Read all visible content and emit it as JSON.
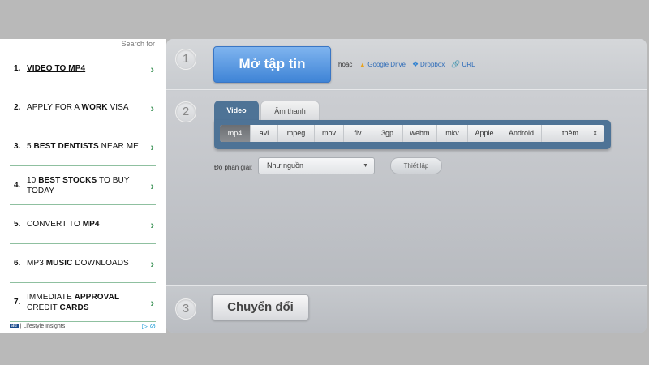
{
  "ad": {
    "search_for": "Search for",
    "items": [
      {
        "num": "1.",
        "parts": [
          {
            "t": "VIDEO TO ",
            "b": false
          },
          {
            "t": "MP4",
            "b": true
          }
        ]
      },
      {
        "num": "2.",
        "parts": [
          {
            "t": "APPLY FOR A ",
            "b": false
          },
          {
            "t": "WORK",
            "b": true
          },
          {
            "t": " VISA",
            "b": false
          }
        ]
      },
      {
        "num": "3.",
        "parts": [
          {
            "t": "5 ",
            "b": false
          },
          {
            "t": "BEST DENTISTS",
            "b": true
          },
          {
            "t": " NEAR ME",
            "b": false
          }
        ]
      },
      {
        "num": "4.",
        "parts": [
          {
            "t": "10 ",
            "b": false
          },
          {
            "t": "BEST STOCKS",
            "b": true
          },
          {
            "t": " TO BUY TODAY",
            "b": false
          }
        ]
      },
      {
        "num": "5.",
        "parts": [
          {
            "t": "CONVERT TO ",
            "b": false
          },
          {
            "t": "MP4",
            "b": true
          }
        ]
      },
      {
        "num": "6.",
        "parts": [
          {
            "t": "MP3 ",
            "b": false
          },
          {
            "t": "MUSIC",
            "b": true
          },
          {
            "t": " DOWNLOADS",
            "b": false
          }
        ]
      },
      {
        "num": "7.",
        "parts": [
          {
            "t": "IMMEDIATE ",
            "b": false
          },
          {
            "t": "APPROVAL",
            "b": true
          },
          {
            "t": " CREDIT ",
            "b": false
          },
          {
            "t": "CARDS",
            "b": true
          }
        ]
      }
    ],
    "chevron": "›",
    "footer_badge": "ad",
    "footer_text": "| Lifestyle Insights",
    "footer_icons": "▷ ⊘"
  },
  "converter": {
    "step1": {
      "number": "1",
      "open_file_label": "Mở tập tin",
      "or_label": "hoặc",
      "sources": [
        {
          "label": "Google Drive",
          "icon": "google-drive-icon",
          "glyph": "▲"
        },
        {
          "label": "Dropbox",
          "icon": "dropbox-icon",
          "glyph": "❖"
        },
        {
          "label": "URL",
          "icon": "link-icon",
          "glyph": "🔗"
        }
      ]
    },
    "step2": {
      "number": "2",
      "tabs": [
        "Video",
        "Âm thanh"
      ],
      "formats": [
        "mp4",
        "avi",
        "mpeg",
        "mov",
        "flv",
        "3gp",
        "webm",
        "mkv",
        "Apple",
        "Android",
        "thêm"
      ],
      "active_format": "mp4",
      "more_arrows": "⇕",
      "resolution_label": "Độ phân giải:",
      "resolution_value": "Như nguồn",
      "settings_label": "Thiết lập"
    },
    "step3": {
      "number": "3",
      "convert_label": "Chuyển đổi"
    }
  }
}
